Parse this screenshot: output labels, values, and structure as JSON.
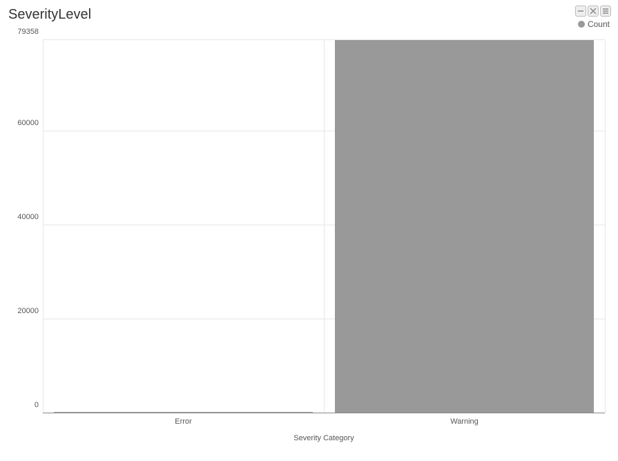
{
  "chart_data": {
    "type": "bar",
    "title": "SeverityLevel",
    "xlabel": "Severity Category",
    "ylabel": "",
    "categories": [
      "Error",
      "Warning"
    ],
    "values": [
      300,
      79358
    ],
    "ylim": [
      0,
      79358
    ],
    "yticks": [
      0,
      20000,
      40000,
      60000,
      79358
    ],
    "series": [
      {
        "name": "Count",
        "values": [
          300,
          79358
        ]
      }
    ]
  },
  "legend": {
    "label": "Count"
  },
  "toolbar": {
    "btn1": "collapse",
    "btn2": "expand",
    "btn3": "menu"
  }
}
